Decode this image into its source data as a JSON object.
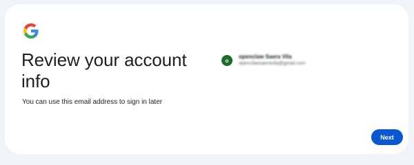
{
  "header": {
    "logo_icon": "google-g-icon",
    "title": "Review your account info",
    "subtitle": "You can use this email address to sign in later"
  },
  "account": {
    "avatar_letter": "o",
    "avatar_color": "#1e6b2c",
    "name": "openclaw Saera Vila",
    "email": "openclawsaeravila@gmail.com"
  },
  "actions": {
    "next_label": "Next",
    "next_color": "#0b57d0"
  }
}
